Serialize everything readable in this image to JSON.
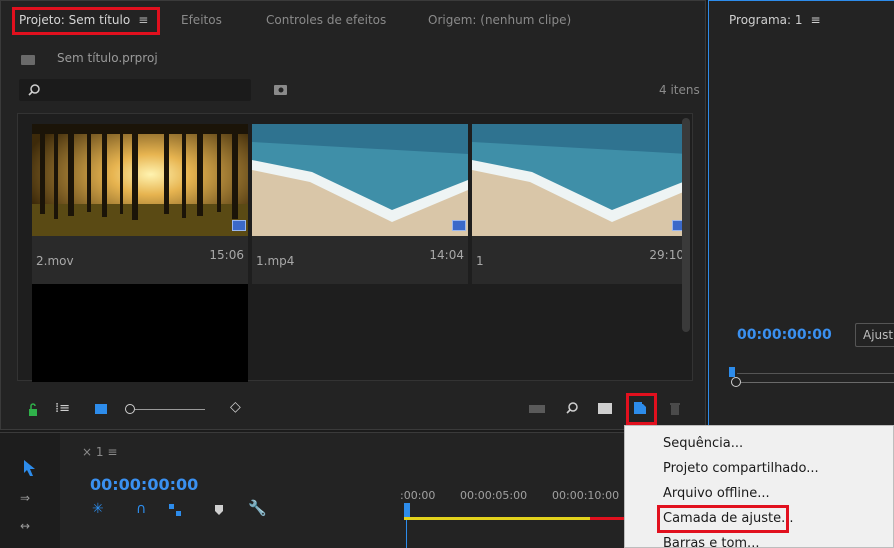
{
  "project": {
    "tabs": [
      {
        "label": "Projeto: Sem título"
      },
      {
        "label": "Efeitos"
      },
      {
        "label": "Controles de efeitos"
      },
      {
        "label": "Origem: (nenhum clipe)"
      }
    ],
    "file_name": "Sem título.prproj",
    "item_count": "4 itens",
    "clips": [
      {
        "name": "2.mov",
        "duration": "15:06"
      },
      {
        "name": "1.mp4",
        "duration": "14:04"
      },
      {
        "name": "1",
        "duration": "29:10"
      },
      {
        "name": "",
        "duration": ""
      }
    ]
  },
  "program": {
    "title": "Programa: 1",
    "timecode": "00:00:00:00",
    "fit_label": "Ajust"
  },
  "timeline": {
    "tab_label": "1",
    "timecode": "00:00:00:00",
    "ruler": [
      ":00:00",
      "00:00:05:00",
      "00:00:10:00"
    ]
  },
  "menu": {
    "items": [
      "Sequência...",
      "Projeto compartilhado...",
      "Arquivo offline...",
      "Camada de ajuste...",
      "Barras e tom..."
    ]
  },
  "colors": {
    "accent": "#2d8ceb",
    "highlight": "#e1101e",
    "timecode": "#3a90f0"
  }
}
